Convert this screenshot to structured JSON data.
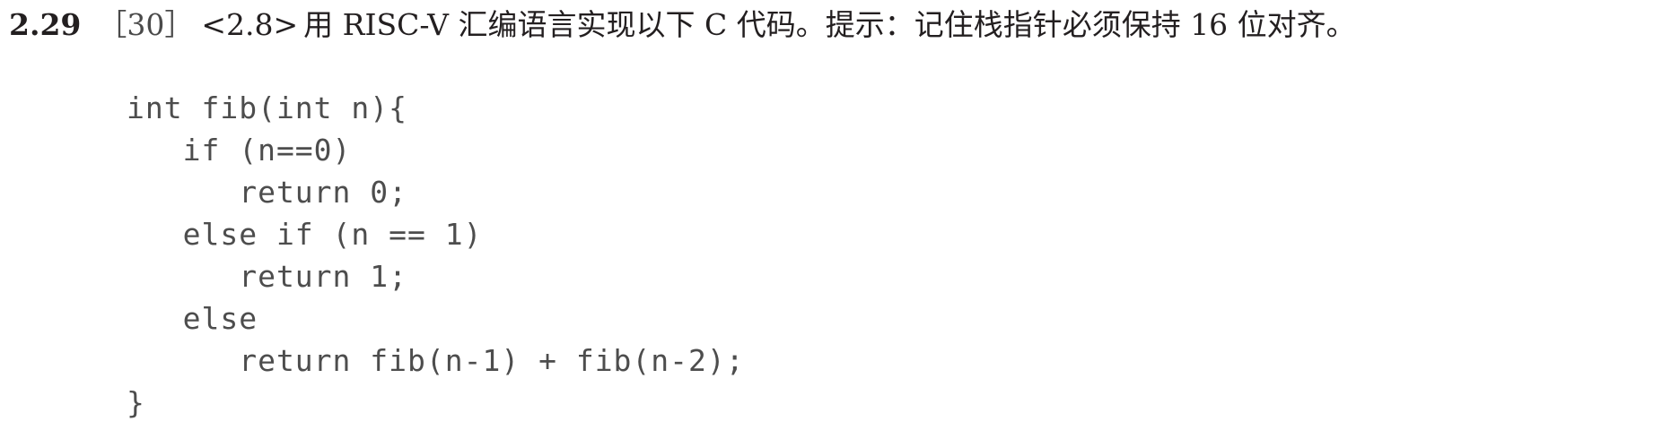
{
  "exercise": {
    "number": "2.29",
    "difficulty": "［30］",
    "section_ref": "<2.8>",
    "prompt": "用 RISC-V 汇编语言实现以下 C 代码。提示：记住栈指针必须保持 16 位对齐。"
  },
  "code": {
    "lines": [
      "int fib(int n){",
      "   if (n==0)",
      "      return 0;",
      "   else if (n == 1)",
      "      return 1;",
      "   else",
      "      return fib(n-1) + fib(n-2);",
      "}"
    ]
  }
}
